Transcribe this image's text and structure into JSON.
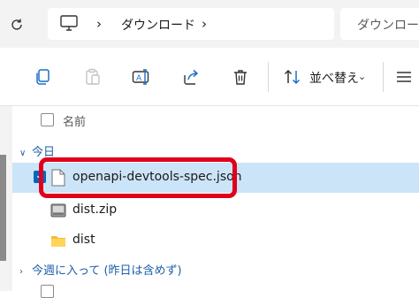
{
  "address_bar": {
    "location_icon": "this-pc-icon",
    "breadcrumbs": [
      {
        "label": "ダウンロード"
      }
    ],
    "search_placeholder": "ダウンロード"
  },
  "toolbar": {
    "actions": [
      "copy-icon",
      "paste-icon",
      "rename-icon",
      "share-icon",
      "delete-icon"
    ],
    "sort_label": "並べ替え",
    "view_icon": "view-options-icon"
  },
  "file_list": {
    "column_header": "名前",
    "groups": [
      {
        "label": "今日",
        "expanded": true,
        "items": [
          {
            "name": "openapi-devtools-spec.json",
            "type": "json-file",
            "icon": "file-icon",
            "selected": true,
            "highlighted": true
          },
          {
            "name": "dist.zip",
            "type": "zip-archive",
            "icon": "zip-icon",
            "selected": false
          },
          {
            "name": "dist",
            "type": "folder",
            "icon": "folder-icon",
            "selected": false
          }
        ]
      },
      {
        "label": "今週に入って (昨日は含めず)",
        "expanded": false,
        "items": []
      }
    ]
  },
  "colors": {
    "selection": "#cce4f7",
    "highlight_border": "#e0001b",
    "accent": "#0067c0",
    "group_text": "#1d5fa8"
  }
}
